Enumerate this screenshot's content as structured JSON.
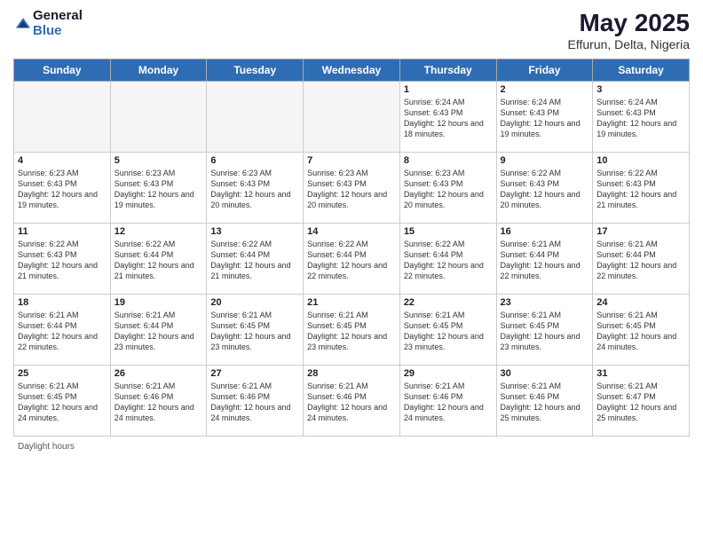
{
  "header": {
    "logo_general": "General",
    "logo_blue": "Blue",
    "month_title": "May 2025",
    "location": "Effurun, Delta, Nigeria"
  },
  "days_of_week": [
    "Sunday",
    "Monday",
    "Tuesday",
    "Wednesday",
    "Thursday",
    "Friday",
    "Saturday"
  ],
  "weeks": [
    [
      {
        "day": "",
        "info": ""
      },
      {
        "day": "",
        "info": ""
      },
      {
        "day": "",
        "info": ""
      },
      {
        "day": "",
        "info": ""
      },
      {
        "day": "1",
        "info": "Sunrise: 6:24 AM\nSunset: 6:43 PM\nDaylight: 12 hours\nand 18 minutes."
      },
      {
        "day": "2",
        "info": "Sunrise: 6:24 AM\nSunset: 6:43 PM\nDaylight: 12 hours\nand 19 minutes."
      },
      {
        "day": "3",
        "info": "Sunrise: 6:24 AM\nSunset: 6:43 PM\nDaylight: 12 hours\nand 19 minutes."
      }
    ],
    [
      {
        "day": "4",
        "info": "Sunrise: 6:23 AM\nSunset: 6:43 PM\nDaylight: 12 hours\nand 19 minutes."
      },
      {
        "day": "5",
        "info": "Sunrise: 6:23 AM\nSunset: 6:43 PM\nDaylight: 12 hours\nand 19 minutes."
      },
      {
        "day": "6",
        "info": "Sunrise: 6:23 AM\nSunset: 6:43 PM\nDaylight: 12 hours\nand 20 minutes."
      },
      {
        "day": "7",
        "info": "Sunrise: 6:23 AM\nSunset: 6:43 PM\nDaylight: 12 hours\nand 20 minutes."
      },
      {
        "day": "8",
        "info": "Sunrise: 6:23 AM\nSunset: 6:43 PM\nDaylight: 12 hours\nand 20 minutes."
      },
      {
        "day": "9",
        "info": "Sunrise: 6:22 AM\nSunset: 6:43 PM\nDaylight: 12 hours\nand 20 minutes."
      },
      {
        "day": "10",
        "info": "Sunrise: 6:22 AM\nSunset: 6:43 PM\nDaylight: 12 hours\nand 21 minutes."
      }
    ],
    [
      {
        "day": "11",
        "info": "Sunrise: 6:22 AM\nSunset: 6:43 PM\nDaylight: 12 hours\nand 21 minutes."
      },
      {
        "day": "12",
        "info": "Sunrise: 6:22 AM\nSunset: 6:44 PM\nDaylight: 12 hours\nand 21 minutes."
      },
      {
        "day": "13",
        "info": "Sunrise: 6:22 AM\nSunset: 6:44 PM\nDaylight: 12 hours\nand 21 minutes."
      },
      {
        "day": "14",
        "info": "Sunrise: 6:22 AM\nSunset: 6:44 PM\nDaylight: 12 hours\nand 22 minutes."
      },
      {
        "day": "15",
        "info": "Sunrise: 6:22 AM\nSunset: 6:44 PM\nDaylight: 12 hours\nand 22 minutes."
      },
      {
        "day": "16",
        "info": "Sunrise: 6:21 AM\nSunset: 6:44 PM\nDaylight: 12 hours\nand 22 minutes."
      },
      {
        "day": "17",
        "info": "Sunrise: 6:21 AM\nSunset: 6:44 PM\nDaylight: 12 hours\nand 22 minutes."
      }
    ],
    [
      {
        "day": "18",
        "info": "Sunrise: 6:21 AM\nSunset: 6:44 PM\nDaylight: 12 hours\nand 22 minutes."
      },
      {
        "day": "19",
        "info": "Sunrise: 6:21 AM\nSunset: 6:44 PM\nDaylight: 12 hours\nand 23 minutes."
      },
      {
        "day": "20",
        "info": "Sunrise: 6:21 AM\nSunset: 6:45 PM\nDaylight: 12 hours\nand 23 minutes."
      },
      {
        "day": "21",
        "info": "Sunrise: 6:21 AM\nSunset: 6:45 PM\nDaylight: 12 hours\nand 23 minutes."
      },
      {
        "day": "22",
        "info": "Sunrise: 6:21 AM\nSunset: 6:45 PM\nDaylight: 12 hours\nand 23 minutes."
      },
      {
        "day": "23",
        "info": "Sunrise: 6:21 AM\nSunset: 6:45 PM\nDaylight: 12 hours\nand 23 minutes."
      },
      {
        "day": "24",
        "info": "Sunrise: 6:21 AM\nSunset: 6:45 PM\nDaylight: 12 hours\nand 24 minutes."
      }
    ],
    [
      {
        "day": "25",
        "info": "Sunrise: 6:21 AM\nSunset: 6:45 PM\nDaylight: 12 hours\nand 24 minutes."
      },
      {
        "day": "26",
        "info": "Sunrise: 6:21 AM\nSunset: 6:46 PM\nDaylight: 12 hours\nand 24 minutes."
      },
      {
        "day": "27",
        "info": "Sunrise: 6:21 AM\nSunset: 6:46 PM\nDaylight: 12 hours\nand 24 minutes."
      },
      {
        "day": "28",
        "info": "Sunrise: 6:21 AM\nSunset: 6:46 PM\nDaylight: 12 hours\nand 24 minutes."
      },
      {
        "day": "29",
        "info": "Sunrise: 6:21 AM\nSunset: 6:46 PM\nDaylight: 12 hours\nand 24 minutes."
      },
      {
        "day": "30",
        "info": "Sunrise: 6:21 AM\nSunset: 6:46 PM\nDaylight: 12 hours\nand 25 minutes."
      },
      {
        "day": "31",
        "info": "Sunrise: 6:21 AM\nSunset: 6:47 PM\nDaylight: 12 hours\nand 25 minutes."
      }
    ]
  ],
  "footer": {
    "daylight_label": "Daylight hours"
  }
}
